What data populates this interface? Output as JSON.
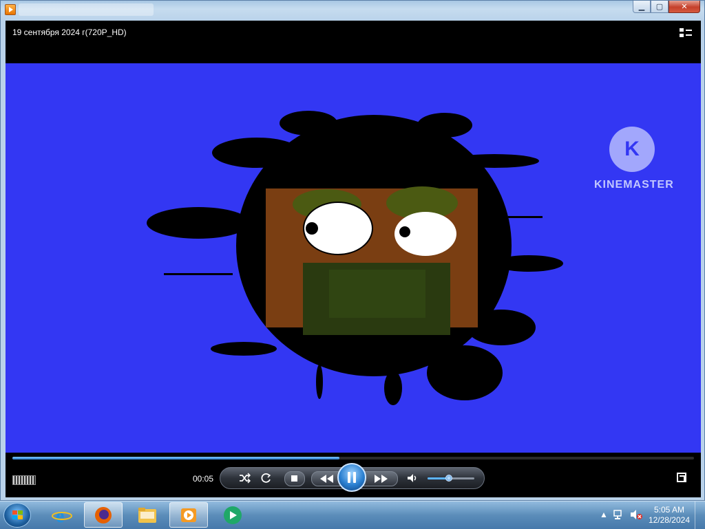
{
  "window": {
    "controls": {
      "minimize": "▁",
      "maximize": "▢",
      "close": "✕"
    }
  },
  "player": {
    "video_title": "19 сентября 2024 г(720P_HD)",
    "watermark": "KINEMASTER",
    "watermark_logo_letter": "K",
    "elapsed_time": "00:05",
    "progress_fraction": 0.48,
    "volume_fraction": 0.45,
    "icons": {
      "switch_view": "switch-to-library-icon",
      "shuffle": "shuffle-icon",
      "repeat": "repeat-icon",
      "stop": "stop-icon",
      "previous": "rewind-icon",
      "play_pause": "pause-icon",
      "next": "fast-forward-icon",
      "mute": "speaker-icon",
      "fullscreen": "fullscreen-icon"
    }
  },
  "taskbar": {
    "time": "5:05 AM",
    "date": "12/28/2024",
    "apps": [
      "Internet Explorer",
      "Firefox",
      "Windows Explorer",
      "Windows Media Player",
      "Windows Media Center"
    ]
  },
  "colors": {
    "video_background": "#3337f3",
    "accent": "#2a7fd0"
  }
}
